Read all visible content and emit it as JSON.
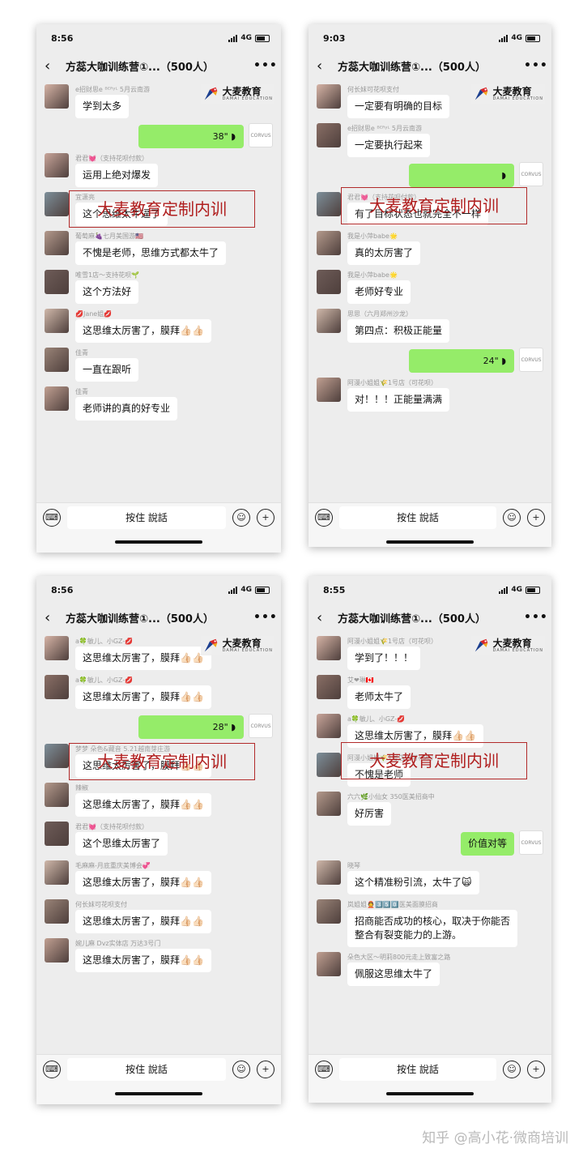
{
  "phones": [
    {
      "time": "8:56",
      "network": "4G",
      "group_title": "方蕊大咖训练营①...",
      "member_count": "（500人）",
      "back_glyph": "‹",
      "more_glyph": "•••",
      "messages": [
        {
          "type": "left",
          "sender": "e招财思e ᴮᴱᴿʸᴸ 5月云南游",
          "text": "学到太多"
        },
        {
          "type": "voice",
          "text": "38\" ◗"
        },
        {
          "type": "left",
          "sender": "君君💓（支持花呗付款）",
          "text": "运用上绝对爆发"
        },
        {
          "type": "left",
          "sender": "宜潇亮",
          "text": "这个思维太牛逼了"
        },
        {
          "type": "left",
          "sender": "葡萄麻🍇七月美国游🇺🇸",
          "text": "不愧是老师，思维方式都太牛了"
        },
        {
          "type": "left",
          "sender": "唯雪1店～支持花呗🌱",
          "text": "这个方法好"
        },
        {
          "type": "left",
          "sender": "💋Jane姐💋",
          "text": "这思维太厉害了，膜拜👍🏻👍🏻"
        },
        {
          "type": "left",
          "sender": "佳青",
          "text": "一直在跟听"
        },
        {
          "type": "left",
          "sender": "佳青",
          "text": "老师讲的真的好专业"
        }
      ]
    },
    {
      "time": "9:03",
      "network": "4G",
      "group_title": "方蕊大咖训练营①...",
      "member_count": "（500人）",
      "back_glyph": "‹",
      "more_glyph": "•••",
      "messages": [
        {
          "type": "left",
          "sender": "何长妹可花呗支付",
          "text": "一定要有明确的目标"
        },
        {
          "type": "left",
          "sender": "e招财思e ᴮᴱᴿʸᴸ 5月云南游",
          "text": "一定要执行起来"
        },
        {
          "type": "voice",
          "text": "◗"
        },
        {
          "type": "left",
          "sender": "君君💓（支持花呗付款）",
          "text": "有了目标状态也就完全不一样"
        },
        {
          "type": "left",
          "sender": "我是小萍babe🌟",
          "text": "真的太厉害了"
        },
        {
          "type": "left",
          "sender": "我是小萍babe🌟",
          "text": "老师好专业"
        },
        {
          "type": "left",
          "sender": "思思（六月郑州沙龙）",
          "text": "第四点：积极正能量"
        },
        {
          "type": "voice",
          "text": "24\" ◗"
        },
        {
          "type": "left",
          "sender": "阿漫小姐姐🌾1号店（可花呗）",
          "text": "对！！！正能量满满"
        }
      ]
    },
    {
      "time": "8:56",
      "network": "4G",
      "group_title": "方蕊大咖训练营①...",
      "member_count": "（500人）",
      "back_glyph": "‹",
      "more_glyph": "•••",
      "messages": [
        {
          "type": "left",
          "sender": "a🍀敏儿、小GZ-💋",
          "text": "这思维太厉害了，膜拜👍🏻👍🏻"
        },
        {
          "type": "left",
          "sender": "a🍀敏儿、小GZ-💋",
          "text": "这思维太厉害了，膜拜👍🏻👍🏻"
        },
        {
          "type": "voice",
          "text": "28\" ◗"
        },
        {
          "type": "left",
          "sender": "梦梦 朵色&藏音 5.21越南芽庄游",
          "text": "这思维太厉害了，膜拜👍🏻👍🏻"
        },
        {
          "type": "left",
          "sender": "辣椒",
          "text": "这思维太厉害了，膜拜👍🏻👍🏻"
        },
        {
          "type": "left",
          "sender": "君君💓（支持花呗付款）",
          "text": "这个思维太厉害了"
        },
        {
          "type": "left",
          "sender": "毛麻麻-月底重庆美博会💞",
          "text": "这思维太厉害了，膜拜👍🏻👍🏻"
        },
        {
          "type": "left",
          "sender": "何长妹可花呗支付",
          "text": "这思维太厉害了，膜拜👍🏻👍🏻"
        },
        {
          "type": "left",
          "sender": "婉儿麻 Dvz实体店 万达3号门",
          "text": "这思维太厉害了，膜拜👍🏻👍🏻"
        }
      ]
    },
    {
      "time": "8:55",
      "network": "4G",
      "group_title": "方蕊大咖训练营①...",
      "member_count": "（500人）",
      "back_glyph": "‹",
      "more_glyph": "•••",
      "messages": [
        {
          "type": "left",
          "sender": "阿漫小姐姐🌾1号店（可花呗）",
          "text": "学到了！！！"
        },
        {
          "type": "left",
          "sender": "艾❤琳🇨🇦",
          "text": "老师太牛了"
        },
        {
          "type": "left",
          "sender": "a🍀敏儿、小GZ-💋",
          "text": "这思维太厉害了，膜拜👍🏻👍🏻"
        },
        {
          "type": "left",
          "sender": "阿漫小姐姐🌾1号店（可花呗）",
          "text": "不愧是老师"
        },
        {
          "type": "left",
          "sender": "六六🌿小仙女 350医美招商中",
          "text": "好厉害"
        },
        {
          "type": "right",
          "text": "价值对等"
        },
        {
          "type": "left",
          "sender": "晓琴",
          "text": "这个精准粉引流，太牛了🙀"
        },
        {
          "type": "left",
          "sender": "岚姐姐👲3️⃣5️⃣0️⃣医美面膜招商",
          "text": "招商能否成功的核心，取决于你能否整合有裂变能力的上游。"
        },
        {
          "type": "left",
          "sender": "朵色大区～明莉800元走上致富之路",
          "text": "佩服这思维太牛了"
        }
      ]
    }
  ],
  "stamp_text": "大麦教育定制内训",
  "logo_text": "大麦教育",
  "logo_subtext": "DAMAI EDUCATION",
  "brand_avatar_text": "CORVUS",
  "input_bar": {
    "voice_key_label": "按住 說話",
    "keyboard_icon": "⌨",
    "emoji_icon": "☺",
    "plus_icon": "+"
  },
  "watermark": "知乎 @高小花·微商培训",
  "colors": {
    "chat_bg": "#ededed",
    "sent_bubble": "#95ec69",
    "stamp_red": "#b01e1e"
  }
}
